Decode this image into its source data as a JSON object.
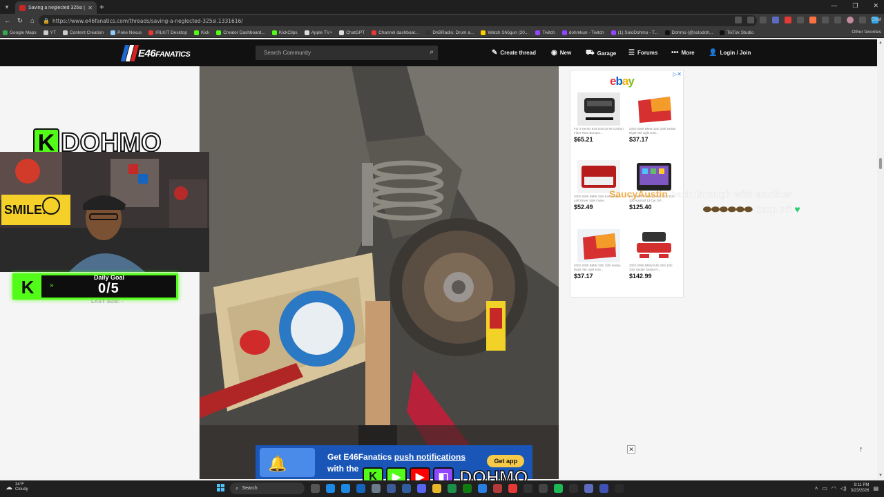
{
  "browser": {
    "tab_title": "Saving a neglected 325si | E46 Fana...",
    "url": "https://www.e46fanatics.com/threads/saving-a-neglected-325si.1331616/",
    "bookmarks": [
      {
        "label": "Google Maps",
        "color": "#34a853"
      },
      {
        "label": "YT",
        "color": "#cccccc"
      },
      {
        "label": "Content Creation",
        "color": "#cccccc"
      },
      {
        "label": "Poke Nexus",
        "color": "#90caf9"
      },
      {
        "label": "IRLKIT Desktop",
        "color": "#e53935"
      },
      {
        "label": "Kick",
        "color": "#53fc18"
      },
      {
        "label": "Creator Dashboard...",
        "color": "#53fc18"
      },
      {
        "label": "KickClips",
        "color": "#53fc18"
      },
      {
        "label": "Apple TV+",
        "color": "#dddddd"
      },
      {
        "label": "ChatGPT",
        "color": "#dddddd"
      },
      {
        "label": "Channel dashboar...",
        "color": "#e53935"
      },
      {
        "label": "DnBRadio: Drum a...",
        "color": "#333333"
      },
      {
        "label": "Watch Shōgun (20...",
        "color": "#ffcc00"
      },
      {
        "label": "Twitch",
        "color": "#9146ff"
      },
      {
        "label": "dohmkun - Twitch",
        "color": "#9146ff"
      },
      {
        "label": "(1) SoloDohmo - T...",
        "color": "#9146ff"
      },
      {
        "label": "Dohmo (@solodoh...",
        "color": "#111111"
      },
      {
        "label": "TikTok Studio",
        "color": "#111111"
      }
    ],
    "other_favorites": "Other favorites",
    "chat_label": "Chat"
  },
  "site": {
    "logo_text": "E46",
    "logo_sub": "FANATICS",
    "search_placeholder": "Search Community",
    "nav": [
      {
        "label": "Create thread",
        "icon": "pencil-icon"
      },
      {
        "label": "New",
        "icon": "new-icon"
      },
      {
        "label": "Garage",
        "icon": "car-icon"
      },
      {
        "label": "Forums",
        "icon": "list-icon"
      },
      {
        "label": "More",
        "icon": "dots-icon"
      },
      {
        "label": "Login / Join",
        "icon": "user-icon"
      }
    ]
  },
  "ad": {
    "brand": "ebay",
    "items": [
      {
        "desc": "For 3 Series E46 E46 02-06 Carbon Fiber Rear Bumper...",
        "price": "$65.21"
      },
      {
        "desc": "2002-2005 BMW 325i 330i Sedan Right Tail Light E46...",
        "price": "$37.17"
      },
      {
        "desc": "2002-2005 BMW 325i E46 Sedan Left Driver Side Outer...",
        "price": "$52.49"
      },
      {
        "desc": "For BMW E46 3 Series 323i 325i 330 Android 13 Car GP...",
        "price": "$125.40"
      },
      {
        "desc": "2002-2005 BMW 325i 330i Sedan Right Tail Light E46...",
        "price": "$37.17"
      },
      {
        "desc": "2002-2005 BMW E46 320i 325i 330i Sedan Sedan R...",
        "price": "$142.99"
      }
    ]
  },
  "stream": {
    "channel": "DOHMO",
    "goal_label": "Daily Goal",
    "goal_count": "0/5",
    "last_sub": "LAST SUB: -",
    "chat_user": "SaucyAustin",
    "chat_message": "back through with another",
    "chat_message_2": "drop off",
    "socials_handle": "DOHMO"
  },
  "push": {
    "line1_prefix": "Get E46Fanatics",
    "line1_link": "push notifications",
    "line2": "with the",
    "button": "Get app"
  },
  "taskbar": {
    "temp": "34°F",
    "condition": "Cloudy",
    "search_placeholder": "Search",
    "time": "9:11 PM",
    "date": "3/23/2026"
  }
}
